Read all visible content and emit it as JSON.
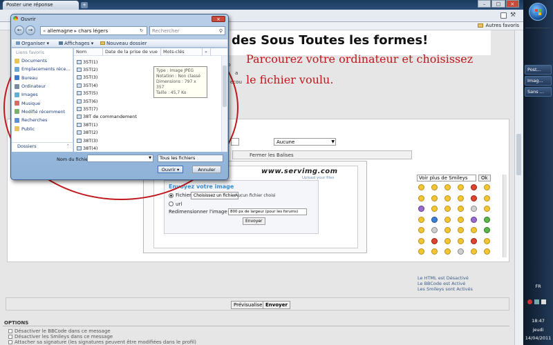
{
  "browser": {
    "tabs": [
      {
        "label": "Poster une réponse"
      }
    ],
    "window_controls": {
      "minimize": "–",
      "maximize": "□",
      "close": "×"
    },
    "bookmarks": {
      "other": "Autres favoris"
    }
  },
  "dialog": {
    "title": "Ouvrir",
    "breadcrumb": [
      "allemagne",
      "chars légers"
    ],
    "search_placeholder": "Rechercher",
    "toolbar": {
      "organize": "Organiser",
      "views": "Affichages",
      "new_folder": "Nouveau dossier"
    },
    "nav": {
      "favorites_header": "Liens favoris",
      "items": [
        "Documents",
        "Emplacements réce...",
        "Bureau",
        "Ordinateur",
        "Images",
        "Musique",
        "Modifié récemment",
        "Recherches",
        "Public"
      ],
      "folders": "Dossiers"
    },
    "columns": [
      "Nom",
      "Date de la prise de vue",
      "Mots-clés"
    ],
    "files": [
      "35T(1)",
      "35T(2)",
      "35T(3)",
      "35T(4)",
      "35T(5)",
      "35T(6)",
      "35T(7)",
      "38T de commandement",
      "38T(1)",
      "38T(2)",
      "38T(3)",
      "38T(4)"
    ],
    "tooltip": [
      "Type : Image JPEG",
      "Notation : Non classé",
      "Dimensions : 797 x 357",
      "Taille : 45,7 Ko"
    ],
    "filename_label": "Nom du fichier :",
    "filename_value": "",
    "filetype": "Tous les fichiers",
    "open_button": "Ouvrir",
    "cancel_button": "Annuler"
  },
  "page": {
    "banner": "des Sous Toutes les formes!",
    "instruction_line1": "Parcourez votre ordinateur et choisissez",
    "instruction_line2": "le fichier voulu.",
    "fragments": [
      "n Bo",
      "a",
      "ecou"
    ],
    "select_value": "Aucune",
    "close_tags": "Fermer les Balises",
    "servimg": {
      "logo": "www.servimg.com",
      "tagline": "Upload your files",
      "heading": "Envoyez votre image",
      "radio_file": "Fichier",
      "choose_button": "Choisissez un fichier",
      "no_file": "Aucun fichier choisi",
      "radio_url": "url",
      "resize_label": "Redimensionner l'image",
      "resize_value": "800 px de largeur (pour les forums)",
      "send_button": "Envoyer"
    },
    "smileys": {
      "select_value": "Voir plus de Smileys",
      "ok": "Ok",
      "html_status": "Le HTML est Désactivé",
      "bbcode_status": "Le BBCode est Activé",
      "smileys_status": "Les Smileys sont Activés"
    },
    "preview_button": "Prévisualiser",
    "submit_button": "Envoyer",
    "options_title": "OPTIONS",
    "options": [
      "Désactiver le BBCode dans ce message",
      "Désactiver les Smileys dans ce message",
      "Attacher sa signature (les signatures peuvent être modifiées dans le profil)"
    ]
  },
  "taskbar": {
    "items": [
      "Post...",
      "Imag...",
      "Sans ..."
    ],
    "lang": "FR",
    "time": "18:47",
    "day": "jeudi",
    "date": "14/04/2011"
  },
  "colors": {
    "annotation_red": "#c0171c",
    "title_bar": "#2c4f79"
  }
}
